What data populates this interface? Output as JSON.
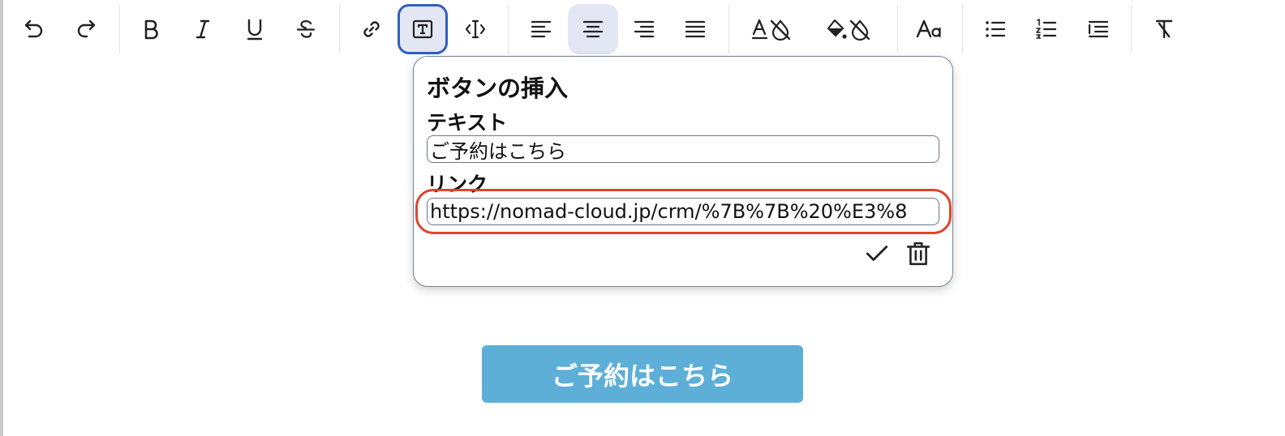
{
  "toolbar": {
    "buttons": [
      {
        "name": "undo",
        "icon": "undo-icon"
      },
      {
        "name": "redo",
        "icon": "redo-icon"
      },
      {
        "name": "bold",
        "icon": "bold-icon",
        "glyph": "B"
      },
      {
        "name": "italic",
        "icon": "italic-icon",
        "glyph": "I"
      },
      {
        "name": "underline",
        "icon": "underline-icon",
        "glyph": "U"
      },
      {
        "name": "strikethrough",
        "icon": "strikethrough-icon",
        "glyph": "S"
      },
      {
        "name": "link",
        "icon": "link-icon"
      },
      {
        "name": "insert-button",
        "icon": "text-box-icon",
        "glyph": "T",
        "state": "focused"
      },
      {
        "name": "text-cursor",
        "icon": "text-cursor-icon"
      },
      {
        "name": "align-left",
        "icon": "align-left-icon"
      },
      {
        "name": "align-center",
        "icon": "align-center-icon",
        "state": "active"
      },
      {
        "name": "align-right",
        "icon": "align-right-icon"
      },
      {
        "name": "align-justify",
        "icon": "align-justify-icon"
      },
      {
        "name": "text-color",
        "icon": "text-color-icon",
        "glyph": "A"
      },
      {
        "name": "fill-color",
        "icon": "fill-color-icon"
      },
      {
        "name": "font-size",
        "icon": "font-size-icon",
        "glyph": "Aa"
      },
      {
        "name": "bullet-list",
        "icon": "bullet-list-icon"
      },
      {
        "name": "numbered-list",
        "icon": "numbered-list-icon"
      },
      {
        "name": "indent",
        "icon": "indent-icon"
      },
      {
        "name": "clear-format",
        "icon": "clear-format-icon",
        "glyph": "T"
      }
    ]
  },
  "popup": {
    "title": "ボタンの挿入",
    "text_label": "テキスト",
    "text_value": "ご予約はこちら",
    "link_label": "リンク",
    "link_value": "https://nomad-cloud.jp/crm/%7B%7B%20%E3%8",
    "confirm_icon": "check-icon",
    "delete_icon": "trash-icon"
  },
  "content": {
    "button_label": "ご予約はこちら",
    "button_color": "#5dafd8"
  },
  "colors": {
    "focus_ring": "#2f5fc4",
    "highlight": "#e0442c",
    "active_bg": "#e3e7f4"
  }
}
